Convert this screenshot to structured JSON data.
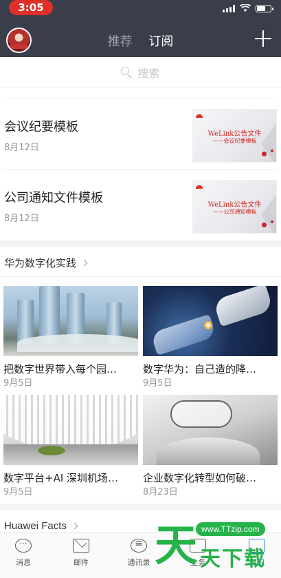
{
  "status_bar": {
    "time": "3:05"
  },
  "header": {
    "tabs": [
      {
        "label": "推荐",
        "active": false
      },
      {
        "label": "订阅",
        "active": true
      }
    ]
  },
  "search": {
    "placeholder": "搜索"
  },
  "articles": [
    {
      "title": "会议纪要模板",
      "date": "8月12日",
      "thumb_title": "WeLink公告文件",
      "thumb_subtitle": "——会议纪要模板"
    },
    {
      "title": "公司通知文件模板",
      "date": "8月12日",
      "thumb_title": "WeLink公告文件",
      "thumb_subtitle": "——公司通知模板"
    }
  ],
  "section": {
    "title": "华为数字化实践",
    "cards": [
      {
        "title": "把数字世界带入每个园…",
        "date": "9月5日",
        "image": "city-towers"
      },
      {
        "title": "数字华为：自己造的降…",
        "date": "9月5日",
        "image": "robot-hand"
      },
      {
        "title": "数字平台+AI 深圳机场…",
        "date": "9月5日",
        "image": "airport-hall"
      },
      {
        "title": "企业数字化转型如何破…",
        "date": "8月23日",
        "image": "cloud-hand"
      }
    ]
  },
  "facts": {
    "title": "Huawei Facts"
  },
  "bottom_nav": [
    {
      "label": "消息",
      "icon": "message-icon"
    },
    {
      "label": "邮件",
      "icon": "mail-icon"
    },
    {
      "label": "通讯录",
      "icon": "contacts-icon"
    },
    {
      "label": "业务",
      "icon": "tasks-icon"
    },
    {
      "label": "知识",
      "icon": "knowledge-icon",
      "active": true
    }
  ],
  "watermark": {
    "big": "天",
    "site": "www.TTzip.com",
    "sub": "天下载"
  },
  "colors": {
    "header_bg": "#3a3d4a",
    "time_pill": "#e0302a",
    "accent": "#2d7ff9",
    "watermark": "#25b34a"
  }
}
